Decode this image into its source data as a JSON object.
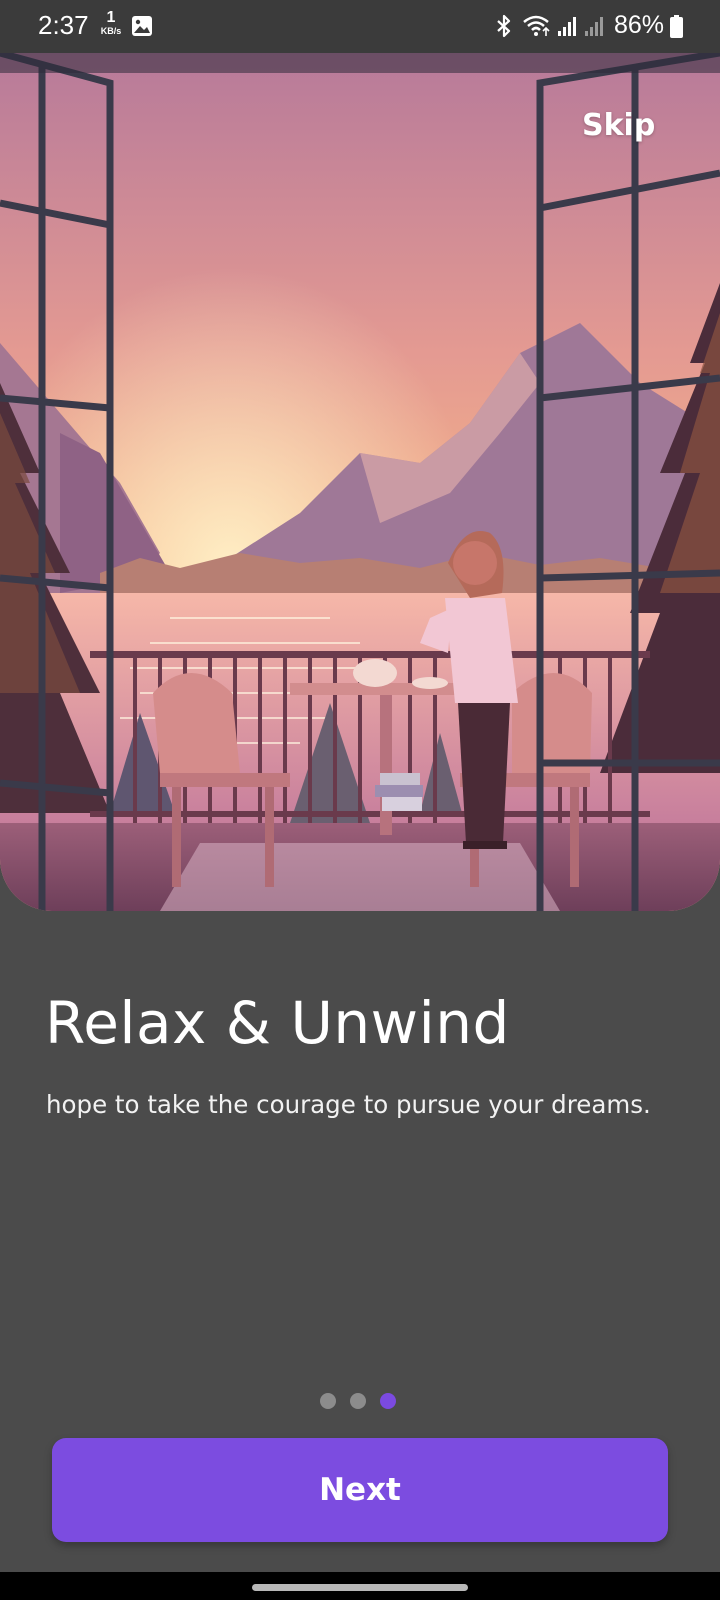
{
  "status_bar": {
    "time": "2:37",
    "net_speed_value": "1",
    "net_speed_unit": "KB/s",
    "battery": "86%",
    "icons": [
      "gallery-icon",
      "bluetooth-icon",
      "wifi-icon",
      "signal-icon",
      "signal-icon-secondary",
      "battery-icon"
    ]
  },
  "onboarding": {
    "skip_label": "Skip",
    "title": "Relax & Unwind",
    "subtitle": "hope to take the courage to pursue your dreams.",
    "page_count": 3,
    "active_page": 3,
    "next_label": "Next"
  },
  "colors": {
    "background": "#4b4b4b",
    "status_bar": "#3b3b3b",
    "accent": "#7c4ce0",
    "dot_inactive": "#8c8c8c"
  }
}
